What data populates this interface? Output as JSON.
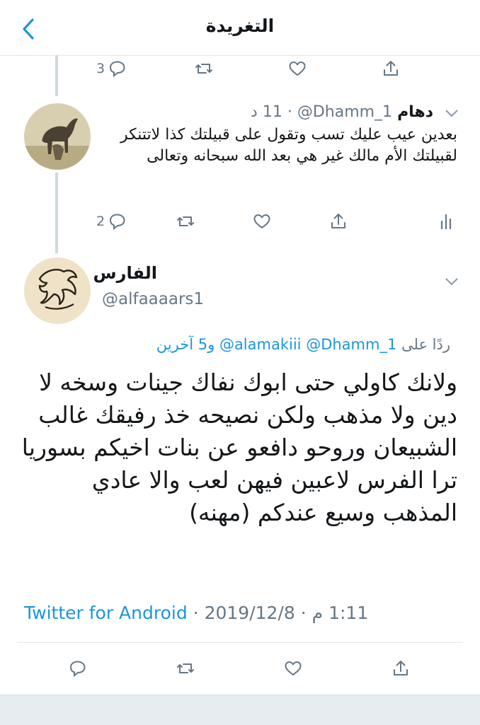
{
  "header": {
    "title": "التغريدة"
  },
  "prev_actions": {
    "reply_count": "3"
  },
  "tweet1": {
    "name": "دهام",
    "handle": "@Dhamm_1",
    "time": "11 د",
    "text": "بعدين عيب عليك تسب وتقول على قبيلتك كذا لاتتنكر لقبيلتك الأم مالك غير هي بعد الله سبحانه وتعالى",
    "reply_count": "2"
  },
  "tweet2": {
    "name": "الفارس",
    "handle": "@alfaaaars1",
    "reply_prefix": "ردًا على",
    "reply_mention1": "@Dhamm_1",
    "reply_mention2": "@alamakiii",
    "reply_others": "و5 آخرين",
    "text": "ولانك كاولي حتى ابوك نفاك جينات وسخه لا دين ولا مذهب ولكن نصيحه خذ رفيقك غالب الشبيعان وروحو دافعو عن بنات اخيكم بسوريا ترا الفرس لاعبين فيهن لعب والا عادي المذهب وسيع عندكم (مهنه)",
    "source": "Twitter for Android",
    "date": "2019/12/8",
    "time": "1:11 م"
  },
  "colors": {
    "accent": "#1b95e0",
    "secondary_text": "#657786",
    "divider": "#e1e8ed"
  }
}
